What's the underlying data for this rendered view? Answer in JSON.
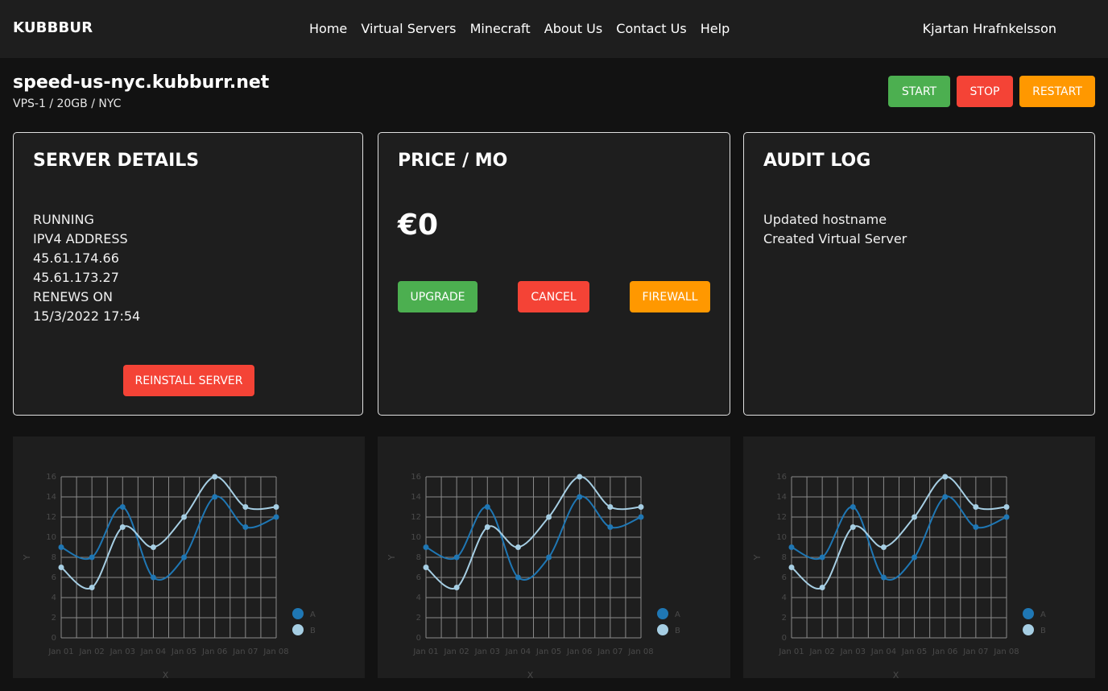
{
  "nav": {
    "brand": "KUBBBUR",
    "links": [
      "Home",
      "Virtual Servers",
      "Minecraft",
      "About Us",
      "Contact Us",
      "Help"
    ],
    "user": "Kjartan Hrafnkelsson"
  },
  "server": {
    "hostname": "speed-us-nyc.kubburr.net",
    "plan": "VPS-1 / 20GB / NYC",
    "actions": {
      "start": "START",
      "stop": "STOP",
      "restart": "RESTART"
    }
  },
  "details": {
    "title": "SERVER DETAILS",
    "status": "RUNNING",
    "ipv4_label": "IPV4 ADDRESS",
    "ips": [
      "45.61.174.66",
      "45.61.173.27"
    ],
    "renews_label": "RENEWS ON",
    "renews_date": "15/3/2022 17:54",
    "reinstall_label": "REINSTALL SERVER"
  },
  "price": {
    "title": "PRICE / MO",
    "value": "€0",
    "upgrade_label": "UPGRADE",
    "cancel_label": "CANCEL",
    "firewall_label": "FIREWALL"
  },
  "audit": {
    "title": "AUDIT LOG",
    "entries": [
      "Updated hostname",
      "Created Virtual Server"
    ]
  },
  "colors": {
    "green": "#4caf50",
    "red": "#f44336",
    "orange": "#ff9800",
    "series_a": "#1f77b4",
    "series_b": "#a6cee3"
  },
  "chart_data": [
    {
      "type": "line",
      "categories": [
        "Jan 01",
        "Jan 02",
        "Jan 03",
        "Jan 04",
        "Jan 05",
        "Jan 06",
        "Jan 07",
        "Jan 08"
      ],
      "series": [
        {
          "name": "A",
          "values": [
            9,
            8,
            13,
            6,
            8,
            14,
            11,
            12
          ]
        },
        {
          "name": "B",
          "values": [
            7,
            5,
            11,
            9,
            12,
            16,
            13,
            13
          ]
        }
      ],
      "xlabel": "X",
      "ylabel": "Y",
      "ylim": [
        0,
        16
      ],
      "yticks": [
        0,
        2,
        4,
        6,
        8,
        10,
        12,
        14,
        16
      ],
      "grid": true,
      "legend": "right"
    },
    {
      "type": "line",
      "categories": [
        "Jan 01",
        "Jan 02",
        "Jan 03",
        "Jan 04",
        "Jan 05",
        "Jan 06",
        "Jan 07",
        "Jan 08"
      ],
      "series": [
        {
          "name": "A",
          "values": [
            9,
            8,
            13,
            6,
            8,
            14,
            11,
            12
          ]
        },
        {
          "name": "B",
          "values": [
            7,
            5,
            11,
            9,
            12,
            16,
            13,
            13
          ]
        }
      ],
      "xlabel": "X",
      "ylabel": "Y",
      "ylim": [
        0,
        16
      ],
      "yticks": [
        0,
        2,
        4,
        6,
        8,
        10,
        12,
        14,
        16
      ],
      "grid": true,
      "legend": "right"
    },
    {
      "type": "line",
      "categories": [
        "Jan 01",
        "Jan 02",
        "Jan 03",
        "Jan 04",
        "Jan 05",
        "Jan 06",
        "Jan 07",
        "Jan 08"
      ],
      "series": [
        {
          "name": "A",
          "values": [
            9,
            8,
            13,
            6,
            8,
            14,
            11,
            12
          ]
        },
        {
          "name": "B",
          "values": [
            7,
            5,
            11,
            9,
            12,
            16,
            13,
            13
          ]
        }
      ],
      "xlabel": "X",
      "ylabel": "Y",
      "ylim": [
        0,
        16
      ],
      "yticks": [
        0,
        2,
        4,
        6,
        8,
        10,
        12,
        14,
        16
      ],
      "grid": true,
      "legend": "right"
    }
  ]
}
